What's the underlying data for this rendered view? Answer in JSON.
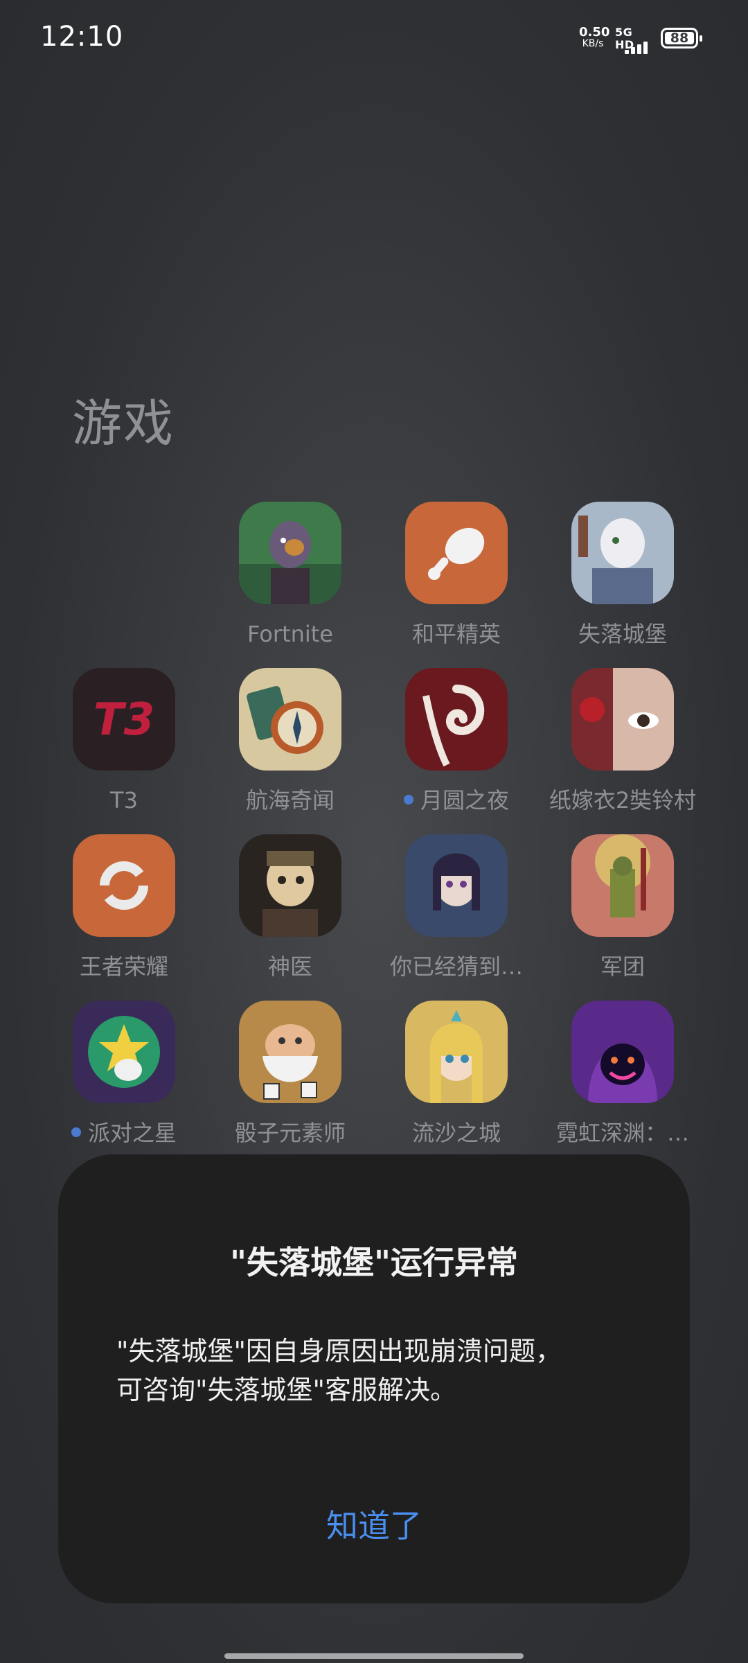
{
  "status_bar": {
    "time": "12:10",
    "net_speed_value": "0.50",
    "net_speed_unit": "KB/s",
    "network_label": "5G HD",
    "battery": "88"
  },
  "folder": {
    "title": "游戏",
    "apps": [
      {
        "label": "Fortnite",
        "icon": "fortnite-icon",
        "dot": false
      },
      {
        "label": "和平精英",
        "icon": "drumstick-icon",
        "dot": false
      },
      {
        "label": "失落城堡",
        "icon": "lost-castle-icon",
        "dot": false
      },
      {
        "label": "T3",
        "icon": "t3-icon",
        "dot": false
      },
      {
        "label": "航海奇闻",
        "icon": "compass-icon",
        "dot": false
      },
      {
        "label": "月圆之夜",
        "icon": "swirl-icon",
        "dot": true
      },
      {
        "label": "纸嫁衣2奘铃村",
        "icon": "face-icon",
        "dot": false
      },
      {
        "label": "王者荣耀",
        "icon": "refresh-icon",
        "dot": false
      },
      {
        "label": "神医",
        "icon": "doctor-icon",
        "dot": false
      },
      {
        "label": "你已经猜到…",
        "icon": "anime-girl-icon",
        "dot": false
      },
      {
        "label": "军团",
        "icon": "legion-icon",
        "dot": false
      },
      {
        "label": "派对之星",
        "icon": "party-star-icon",
        "dot": true
      },
      {
        "label": "骰子元素师",
        "icon": "dice-wizard-icon",
        "dot": false
      },
      {
        "label": "流沙之城",
        "icon": "blonde-girl-icon",
        "dot": false
      },
      {
        "label": "霓虹深渊：…",
        "icon": "neon-hood-icon",
        "dot": false
      }
    ]
  },
  "dialog": {
    "title": "\"失落城堡\"运行异常",
    "message_line1": "\"失落城堡\"因自身原因出现崩溃问题，",
    "message_line2": "可咨询\"失落城堡\"客服解决。",
    "confirm_label": "知道了"
  },
  "colors": {
    "dialog_bg": "#1f1f20",
    "accent": "#4a8ff0",
    "label_gray": "#909194",
    "dot_blue": "#4b7ad0"
  }
}
